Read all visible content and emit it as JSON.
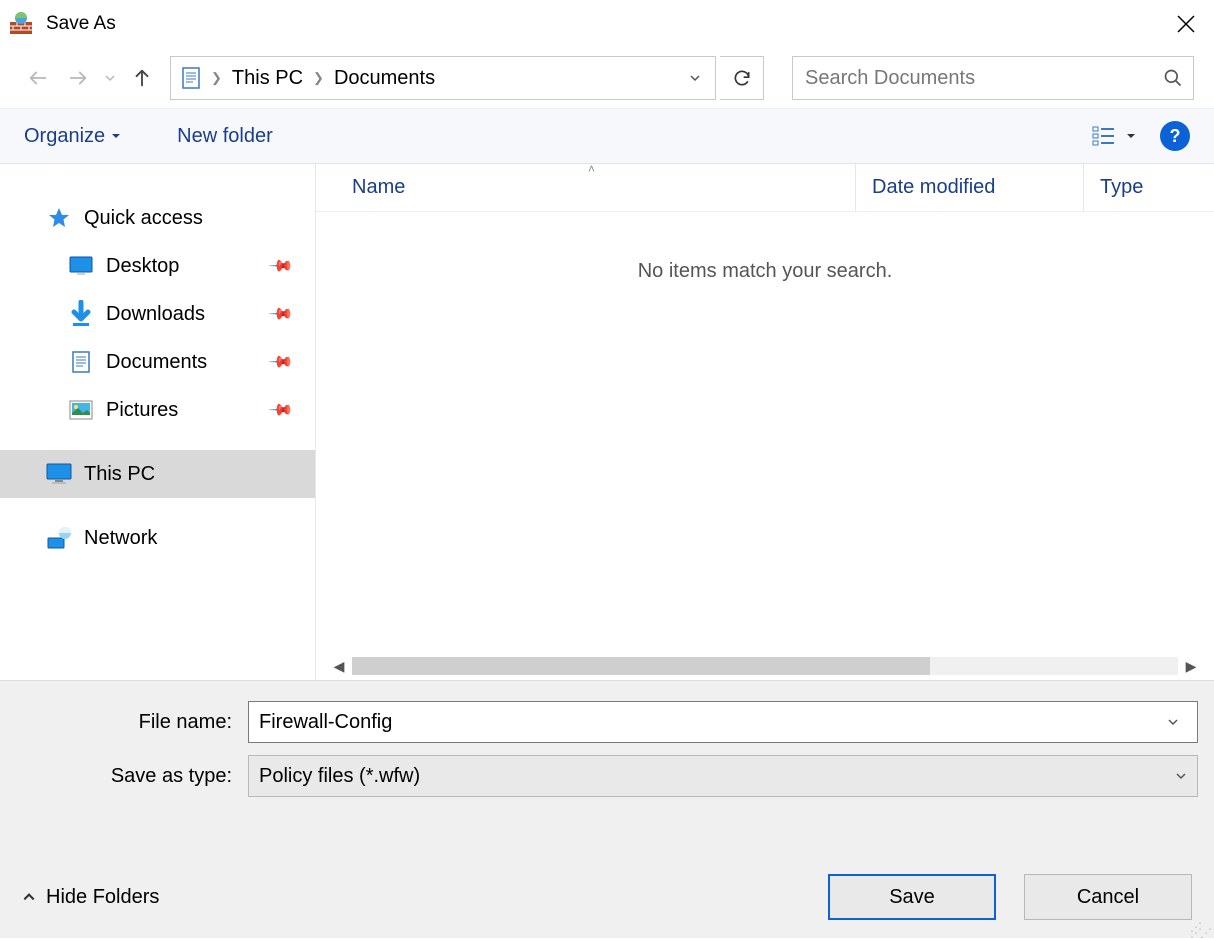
{
  "window": {
    "title": "Save As"
  },
  "nav": {
    "breadcrumbs": [
      "This PC",
      "Documents"
    ],
    "search_placeholder": "Search Documents"
  },
  "toolbar": {
    "organize": "Organize",
    "new_folder": "New folder"
  },
  "sidebar": {
    "items": [
      {
        "label": "Quick access",
        "icon": "star",
        "pinned": false,
        "sub": false,
        "selected": false
      },
      {
        "label": "Desktop",
        "icon": "desktop",
        "pinned": true,
        "sub": true,
        "selected": false
      },
      {
        "label": "Downloads",
        "icon": "download",
        "pinned": true,
        "sub": true,
        "selected": false
      },
      {
        "label": "Documents",
        "icon": "document",
        "pinned": true,
        "sub": true,
        "selected": false
      },
      {
        "label": "Pictures",
        "icon": "picture",
        "pinned": true,
        "sub": true,
        "selected": false
      },
      {
        "label": "This PC",
        "icon": "pc",
        "pinned": false,
        "sub": false,
        "selected": true
      },
      {
        "label": "Network",
        "icon": "network",
        "pinned": false,
        "sub": false,
        "selected": false
      }
    ]
  },
  "columns": {
    "name": "Name",
    "date": "Date modified",
    "type": "Type"
  },
  "content": {
    "empty_message": "No items match your search."
  },
  "form": {
    "filename_label": "File name:",
    "filename_value": "Firewall-Config",
    "type_label": "Save as type:",
    "type_value": "Policy files (*.wfw)",
    "hide_folders": "Hide Folders",
    "save": "Save",
    "cancel": "Cancel"
  }
}
